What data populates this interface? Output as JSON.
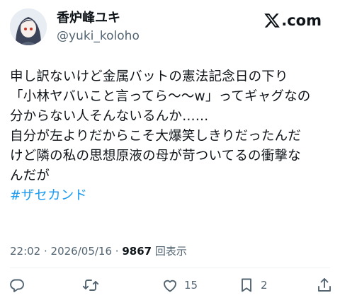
{
  "author": {
    "display_name": "香炉峰ユキ",
    "handle": "@yuki_koloho"
  },
  "brand": {
    "label": ".com",
    "icon": "x-logo-icon"
  },
  "post": {
    "lines": [
      "申し訳ないけど金属バットの憲法記念日の下り",
      "「小林ヤバいこと言ってら〜〜w」ってギャグなの",
      "分からない人そんないるんか……",
      "自分が左よりだからこそ大爆笑しきりだったんだ",
      "けど隣の私の思想原液の母が苛ついてるの衝撃な",
      "んだが"
    ],
    "hashtag": "#ザセカンド"
  },
  "meta": {
    "time": "22:02",
    "separator1": " · ",
    "date": "2026/05/16",
    "separator2": " · ",
    "views_count": "9867",
    "views_label": " 回表示"
  },
  "actions": {
    "reply": {
      "icon": "reply-icon",
      "count": ""
    },
    "repost": {
      "icon": "repost-icon",
      "count": ""
    },
    "like": {
      "icon": "heart-icon",
      "count": "15"
    },
    "bookmark": {
      "icon": "bookmark-icon",
      "count": "2"
    },
    "share": {
      "icon": "share-icon",
      "count": ""
    }
  }
}
